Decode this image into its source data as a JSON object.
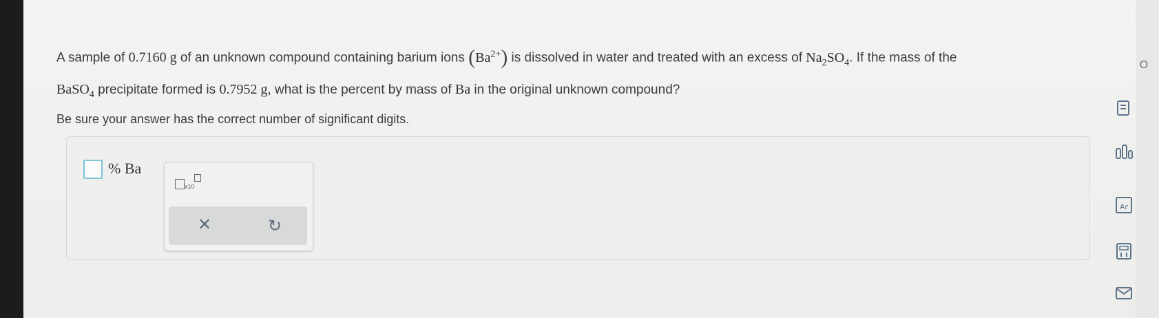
{
  "question": {
    "p1": "A sample of ",
    "mass1": "0.7160 g",
    "p2": " of an unknown compound containing barium ions ",
    "ion": "Ba",
    "ion_charge": "2+",
    "p3": " is dissolved in water and treated with an excess of ",
    "reagent_a": "Na",
    "reagent_a_sub": "2",
    "reagent_b": "SO",
    "reagent_b_sub": "4",
    "p4": ". If the mass of the",
    "precip": "BaSO",
    "precip_sub": "4",
    "p5": " precipitate formed is ",
    "mass2": "0.7952 g",
    "p6": ", what is the percent by mass of ",
    "element": "Ba",
    "p7": " in the original unknown compound?"
  },
  "hint": "Be sure your answer has the correct number of significant digits.",
  "answer": {
    "value": "",
    "unit": "% Ba"
  },
  "toolbox": {
    "sci_notation_label": "x10",
    "clear_symbol": "✕",
    "undo_symbol": "↻"
  },
  "side_icons": [
    "cut-off-icon",
    "notes-icon",
    "data-icon",
    "periodic-table-icon",
    "calculator-icon",
    "mail-icon"
  ]
}
